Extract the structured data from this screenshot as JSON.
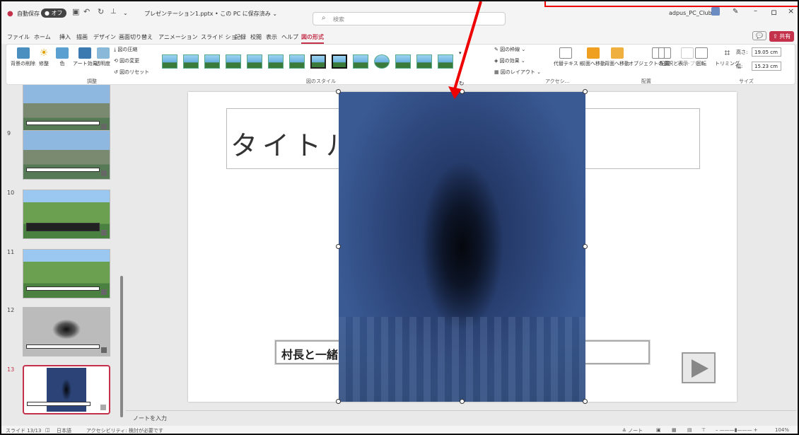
{
  "titlebar": {
    "autosave_label": "自動保存",
    "autosave_state": "オフ",
    "doc_title": "プレゼンテーション1.pptx • この PC に保存済み ⌄",
    "search_placeholder": "検索",
    "account": "adpus_PC_Club",
    "minimize": "–",
    "restore": "ロ",
    "close": "×"
  },
  "menu": [
    "ファイル",
    "ホーム",
    "挿入",
    "描画",
    "デザイン",
    "画面切り替え",
    "アニメーション",
    "スライド ショー",
    "記録",
    "校閲",
    "表示",
    "ヘルプ",
    "図の形式"
  ],
  "share": "共有",
  "ribbon": {
    "adjust": {
      "remove_bg": "背景の削除",
      "corrections": "修整",
      "color": "色",
      "artistic": "アート効果",
      "transparency": "透明度",
      "compress": "図の圧縮",
      "change": "図の変更",
      "reset": "図のリセット",
      "group": "調整"
    },
    "styles_group": "図のスタイル",
    "border": "図の枠線",
    "effects": "図の効果",
    "layout": "図のレイアウト",
    "alt_text": "代替テキスト",
    "accessibility_group": "アクセシ...",
    "bring_forward": "前面へ移動",
    "send_backward": "背面へ移動",
    "selection_pane": "オブジェクトの選択と表示",
    "align": "配置",
    "group_btn": "グループ化",
    "rotate": "回転",
    "arrange_group": "配置",
    "crop": "トリミング",
    "height_label": "高さ:",
    "height": "19.05 cm",
    "width_label": "幅:",
    "width": "15.23 cm",
    "size_group": "サイズ"
  },
  "thumbnails": [
    {
      "num": "9"
    },
    {
      "num": "10"
    },
    {
      "num": "11"
    },
    {
      "num": "12"
    },
    {
      "num": "13"
    }
  ],
  "slide": {
    "title": "タイトルを",
    "caption": "村長と一緒"
  },
  "notes": "ノートを入力",
  "status": {
    "slide": "スライド 13/13",
    "lang": "日本語",
    "accessibility": "アクセシビリティ: 検討が必要です",
    "notes_btn": "ノート",
    "zoom": "104%"
  }
}
